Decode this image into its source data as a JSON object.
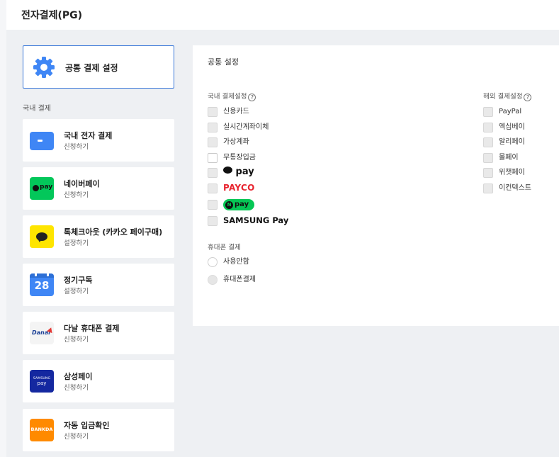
{
  "header": {
    "title": "전자결제(PG)"
  },
  "common": {
    "label": "공통 결제 설정"
  },
  "domestic_section": "국내 결제",
  "services": [
    {
      "name": "국내 전자 결제",
      "sub": "신청하기",
      "icon": "card-icon",
      "color": "#3f86f5"
    },
    {
      "name": "네이버페이",
      "sub": "신청하기",
      "icon": "naverpay-icon",
      "color": "#03c75a",
      "icon_text": "pay"
    },
    {
      "name": "톡체크아웃 (카카오 페이구매)",
      "sub": "설정하기",
      "icon": "kakao-talk-icon",
      "color": "#fee500"
    },
    {
      "name": "정기구독",
      "sub": "설정하기",
      "icon": "calendar-icon",
      "color": "#3f86f5",
      "icon_text": "28"
    },
    {
      "name": "다날 휴대폰 결제",
      "sub": "신청하기",
      "icon": "danal-icon",
      "color": "#f4f4f4",
      "icon_text": "Danal"
    },
    {
      "name": "삼성페이",
      "sub": "신청하기",
      "icon": "samsung-pay-icon",
      "color": "#1428a0",
      "icon_text_1": "SAMSUNG",
      "icon_text_2": "pay"
    },
    {
      "name": "자동 입금확인",
      "sub": "신청하기",
      "icon": "bankda-icon",
      "color": "#ff8a00",
      "icon_text": "BANKDA"
    }
  ],
  "panel": {
    "title": "공통 설정",
    "domestic_label": "국내 결제설정",
    "overseas_label": "해외 결제설정",
    "help_glyph": "?",
    "domestic_options": [
      "신용카드",
      "실시간계좌이체",
      "가상계좌",
      "무통장입금"
    ],
    "brand_options": {
      "kakaopay": "pay",
      "payco": "PAYCO",
      "npay": "pay",
      "npay_mark": "N",
      "samsungpay": "SAMSUNG Pay"
    },
    "overseas_options": [
      "PayPal",
      "엑심베이",
      "알리페이",
      "몰페이",
      "위챗페이",
      "이컨텍스트"
    ],
    "mobile_label": "휴대폰 결제",
    "mobile_options": [
      "사용안함",
      "휴대폰결제"
    ]
  }
}
